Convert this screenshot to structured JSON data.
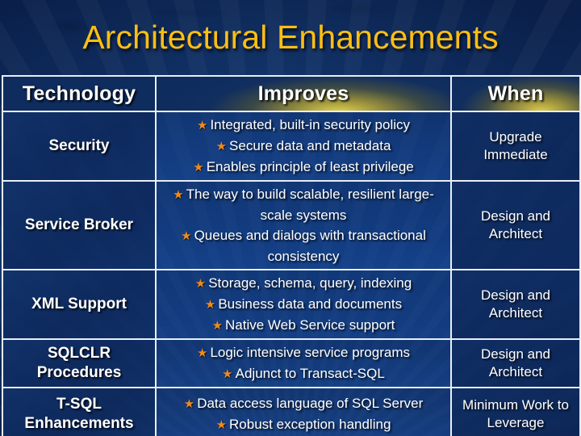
{
  "slide": {
    "title": "Architectural Enhancements",
    "title_color": "#FBBE16",
    "background_color": "#0d2a5c",
    "bullet_glyph": "★",
    "bullet_color": "#F08A1A",
    "header_glow_color": "#F7E04A",
    "text_color": "#FFFFFF",
    "border_color": "#E9EEF6"
  },
  "table": {
    "headers": {
      "technology": "Technology",
      "improves": "Improves",
      "when": "When"
    },
    "rows": [
      {
        "technology": "Security",
        "improves": [
          "Integrated, built-in security policy",
          "Secure data and metadata",
          "Enables principle of least privilege"
        ],
        "when": "Upgrade Immediate"
      },
      {
        "technology": "Service Broker",
        "improves": [
          "The way to build scalable, resilient large-scale systems",
          "Queues and dialogs with transactional consistency"
        ],
        "when": "Design and Architect"
      },
      {
        "technology": "XML Support",
        "improves": [
          "Storage, schema, query, indexing",
          "Business data and documents",
          "Native Web Service support"
        ],
        "when": "Design and Architect"
      },
      {
        "technology": "SQLCLR Procedures",
        "improves": [
          "Logic intensive service programs",
          "Adjunct to Transact-SQL"
        ],
        "when": "Design and Architect"
      },
      {
        "technology": "T-SQL Enhancements",
        "improves": [
          "Data access language of SQL Server",
          "Robust exception handling"
        ],
        "when": "Minimum Work to Leverage"
      }
    ]
  }
}
